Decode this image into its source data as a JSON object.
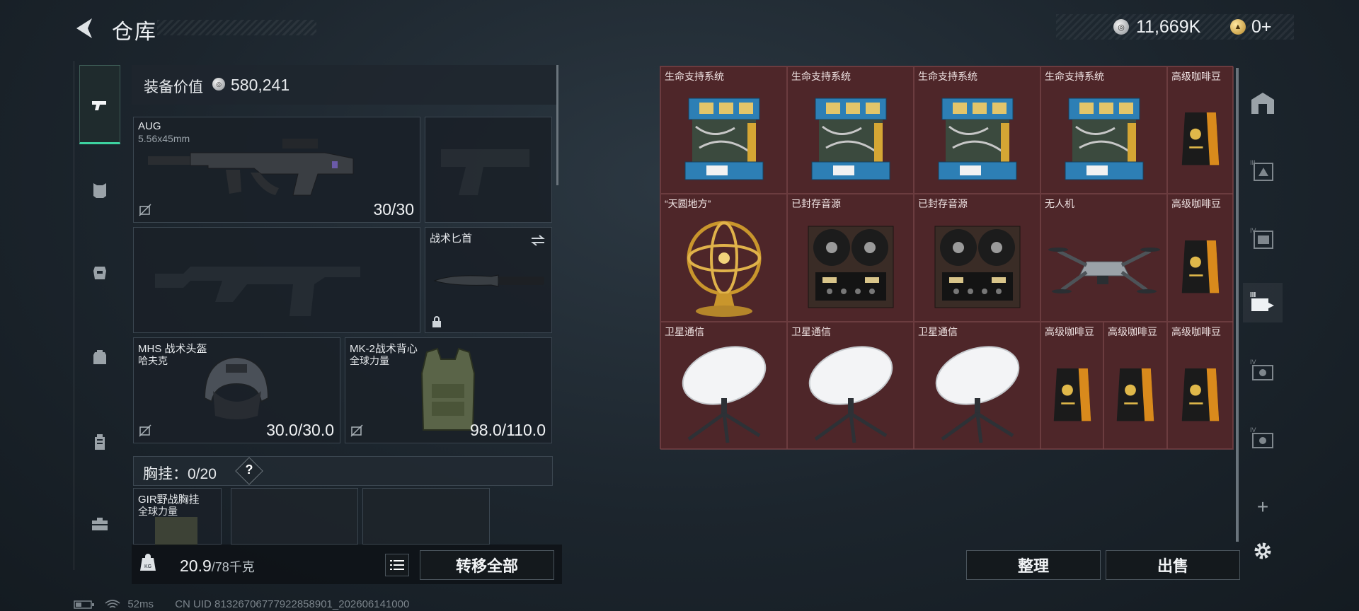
{
  "header": {
    "title": "仓库",
    "currency": {
      "silver": "11,669K",
      "gold": "0+"
    }
  },
  "left_nav": {
    "items": [
      {
        "icon": "pistol-icon",
        "active": true
      },
      {
        "icon": "armor-icon"
      },
      {
        "icon": "vest-icon"
      },
      {
        "icon": "backpack-icon"
      },
      {
        "icon": "luggage-icon"
      },
      {
        "icon": "toolbox-icon"
      }
    ]
  },
  "equipment": {
    "value_label": "装备价值",
    "value": "580,241",
    "primary": {
      "name": "AUG",
      "sub": "5.56x45mm",
      "count": "30/30"
    },
    "knife": {
      "name": "战术匕首"
    },
    "helmet": {
      "name": "MHS 战术头盔",
      "brand": "哈夫克",
      "durability": "30.0/30.0"
    },
    "armor": {
      "name": "MK-2战术背心",
      "brand": "全球力量",
      "durability": "98.0/110.0"
    },
    "chest_rig": {
      "label": "胸挂：",
      "count": "0/20",
      "help": "?",
      "item": {
        "name": "GIR野战胸挂",
        "brand": "全球力量"
      }
    },
    "weight": {
      "current": "20.9",
      "max": "/78千克"
    },
    "transfer_all": "转移全部"
  },
  "inventory": {
    "cells": [
      {
        "label": "生命支持系统",
        "kind": "lifesupport"
      },
      {
        "label": "生命支持系统",
        "kind": "lifesupport"
      },
      {
        "label": "生命支持系统",
        "kind": "lifesupport"
      },
      {
        "label": "生命支持系统",
        "kind": "lifesupport"
      },
      {
        "label": "高级咖啡豆",
        "kind": "coffee"
      },
      {
        "label": "“天圆地方”",
        "kind": "armillary"
      },
      {
        "label": "已封存音源",
        "kind": "tape"
      },
      {
        "label": "已封存音源",
        "kind": "tape"
      },
      {
        "label": "无人机",
        "kind": "drone"
      },
      {
        "label": "高级咖啡豆",
        "kind": "coffee"
      },
      {
        "label": "卫星通信",
        "kind": "dish"
      },
      {
        "label": "卫星通信",
        "kind": "dish"
      },
      {
        "label": "卫星通信",
        "kind": "dish"
      },
      {
        "label": "高级咖啡豆",
        "kind": "coffee"
      },
      {
        "label": "高级咖啡豆",
        "kind": "coffee"
      },
      {
        "label": "高级咖啡豆",
        "kind": "coffee"
      }
    ],
    "sort_button": "整理",
    "sell_button": "出售"
  },
  "stash_nav": {
    "items": [
      {
        "icon": "stash-main-icon"
      },
      {
        "icon": "stash-iii-icon",
        "tier": "III"
      },
      {
        "icon": "stash-iv-icon",
        "tier": "IV"
      },
      {
        "icon": "stash-iii-active-icon",
        "tier": "III",
        "active": true
      },
      {
        "icon": "stash-iv-b-icon",
        "tier": "IV"
      },
      {
        "icon": "stash-iv-c-icon",
        "tier": "IV"
      }
    ],
    "add": "+"
  },
  "status": {
    "ping": "52ms",
    "uid": "CN UID 8132670677792285890​1_202606141000"
  },
  "colors": {
    "accent": "#3dd2a0",
    "inventory_bg": "#4e2629"
  }
}
